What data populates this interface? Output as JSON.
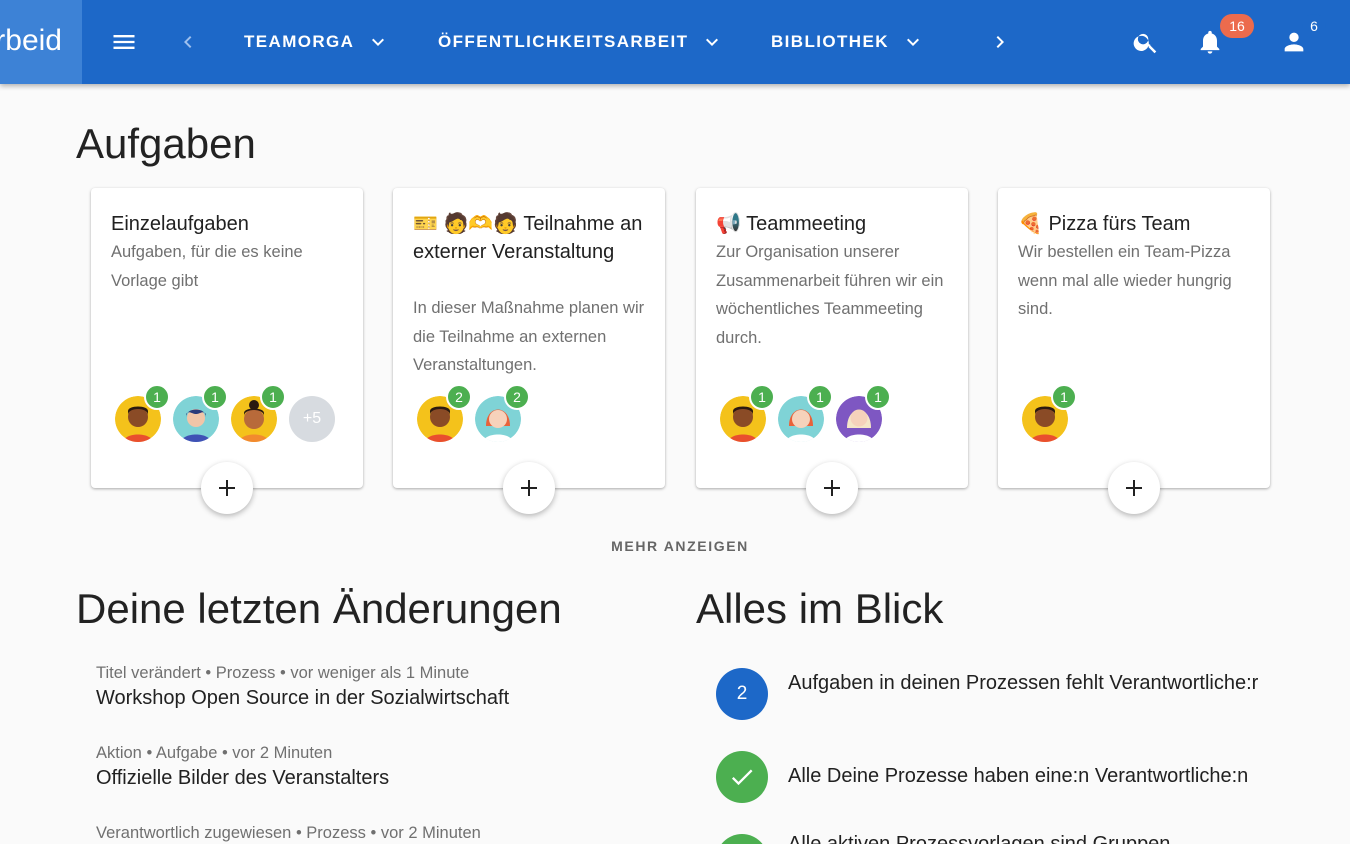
{
  "brand": {
    "text": "rbeid"
  },
  "nav": {
    "tabs": [
      {
        "label": "TEAMORGA"
      },
      {
        "label": "ÖFFENTLICHKEITSARBEIT"
      },
      {
        "label": "BIBLIOTHEK"
      }
    ],
    "notifications_count": "16",
    "users_count": "6"
  },
  "aufgaben": {
    "title": "Aufgaben",
    "cards": [
      {
        "title": "Einzelaufgaben",
        "description": "Aufgaben, für die es keine Vorlage gibt",
        "avatars": [
          {
            "badge": "1"
          },
          {
            "badge": "1"
          },
          {
            "badge": "1"
          }
        ],
        "more": "+5"
      },
      {
        "title": "🎫 🧑🫶🧑 Teilnahme an externer Veranstaltung",
        "description": "In dieser Maßnahme planen wir die Teilnahme an externen Veranstaltungen.",
        "avatars": [
          {
            "badge": "2"
          },
          {
            "badge": "2"
          }
        ]
      },
      {
        "title": "📢 Teammeeting",
        "description": "Zur Organisation unserer Zusammenarbeit führen wir ein wöchentliches Teammeeting durch.",
        "avatars": [
          {
            "badge": "1"
          },
          {
            "badge": "1"
          },
          {
            "badge": "1"
          }
        ]
      },
      {
        "title": "🍕 Pizza fürs Team",
        "description": "Wir bestellen ein Team-Pizza wenn mal alle wieder hungrig sind.",
        "avatars": [
          {
            "badge": "1"
          }
        ]
      }
    ],
    "more_label": "MEHR ANZEIGEN"
  },
  "recent": {
    "title": "Deine letzten Änderungen",
    "items": [
      {
        "meta": "Titel verändert • Prozess • vor weniger als 1 Minute",
        "title": "Workshop Open Source in der Sozialwirtschaft"
      },
      {
        "meta": "Aktion • Aufgabe • vor 2 Minuten",
        "title": "Offizielle Bilder des Veranstalters"
      },
      {
        "meta": "Verantwortlich zugewiesen • Prozess • vor 2 Minuten",
        "title": ""
      }
    ]
  },
  "overview": {
    "title": "Alles im Blick",
    "items": [
      {
        "count": "2",
        "text": "Aufgaben in deinen Prozessen fehlt Verantwortliche:r",
        "status_color": "#1d68c8"
      },
      {
        "text": "Alle Deine Prozesse haben eine:n Verantwortliche:n",
        "status_color": "#4caf50"
      },
      {
        "text": "Alle aktiven Prozessvorlagen sind Gruppen",
        "status_color": "#4caf50"
      }
    ]
  },
  "icons": {
    "menu": "menu-icon",
    "prev": "chevron-left-icon",
    "next": "chevron-right-icon",
    "dropdown": "chevron-down-icon",
    "search": "search-icon",
    "notifications": "bell-icon",
    "users": "user-icon",
    "add": "plus-icon",
    "done": "check-icon"
  },
  "colors": {
    "topbar": "#1d68c8",
    "brand_block": "#3d82d6",
    "badge_orange": "#ec6b4d",
    "badge_green": "#4caf50"
  }
}
